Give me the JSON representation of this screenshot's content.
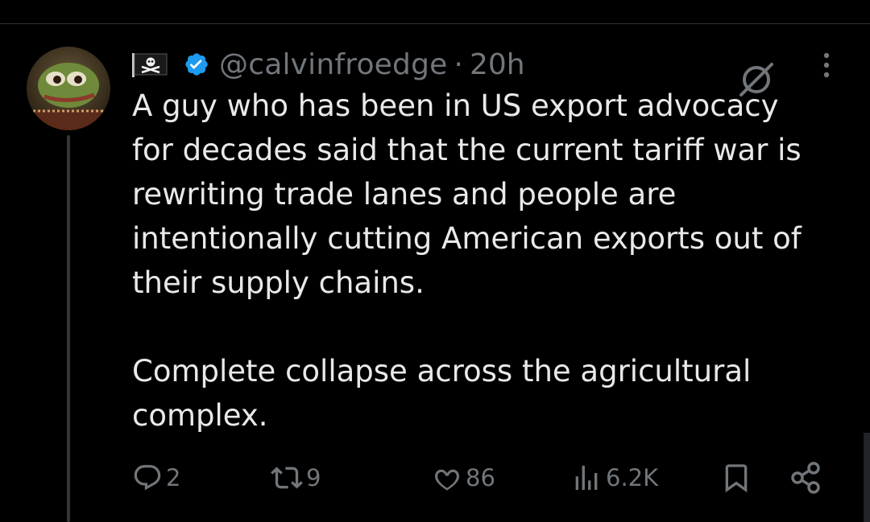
{
  "tweet": {
    "handle": "@calvinfroedge",
    "separator": "·",
    "time": "20h",
    "paragraphs": [
      "A guy who has been in US export advocacy\nfor decades said that the current tariff war is\nrewriting trade lanes and people are\nintentionally cutting American exports out of\ntheir supply chains.",
      "Complete collapse across the agricultural\ncomplex."
    ],
    "flag_icon": "pirate-flag-icon",
    "verified_icon": "verified-badge-icon",
    "verified_color": "#1d9bf0"
  },
  "actions": {
    "replies": "2",
    "reposts": "9",
    "likes": "86",
    "views": "6.2K"
  },
  "colors": {
    "background": "#000000",
    "text": "#e7e9ea",
    "muted": "#71767b",
    "divider": "#2f3336"
  }
}
